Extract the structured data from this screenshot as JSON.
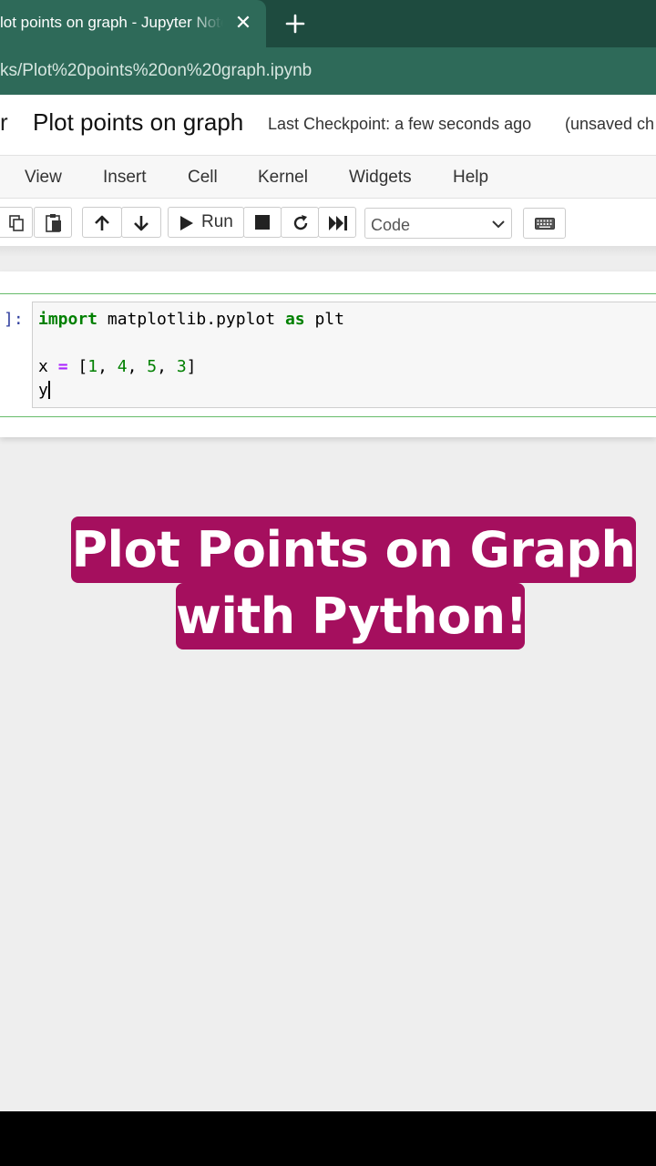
{
  "browser": {
    "tab_title": "lot points on graph - Jupyter Notebook",
    "tab_close": "✕",
    "url": "ks/Plot%20points%20on%20graph.ipynb"
  },
  "notebook_header": {
    "logo_fragment": "r",
    "title": "Plot points on graph",
    "checkpoint": "Last Checkpoint: a few seconds ago",
    "unsaved": "(unsaved ch"
  },
  "menu": {
    "view": "View",
    "insert": "Insert",
    "cell": "Cell",
    "kernel": "Kernel",
    "widgets": "Widgets",
    "help": "Help"
  },
  "toolbar": {
    "run_label": "Run",
    "cell_type": "Code"
  },
  "cell": {
    "prompt": "]:",
    "line1": {
      "kw1": "import",
      "mid": " matplotlib.pyplot ",
      "kw2": "as",
      "end": " plt"
    },
    "line3": {
      "var": "x ",
      "op": "=",
      "open": " [",
      "n1": "1",
      "c1": ", ",
      "n2": "4",
      "c2": ", ",
      "n3": "5",
      "c3": ", ",
      "n4": "3",
      "close": "]"
    },
    "line4": "y"
  },
  "caption": {
    "line1": "Plot Points on Graph",
    "line2": "with Python!"
  },
  "colors": {
    "tab_bar": "#1e4b3f",
    "tab_active": "#2e6a59",
    "caption_bg": "#a50f5e",
    "cell_border": "#66bb6a",
    "keyword": "#008000",
    "operator": "#aa22ff"
  },
  "icons": {
    "toolbar": [
      "copy-icon",
      "paste-icon",
      "arrow-up-icon",
      "arrow-down-icon",
      "play-icon",
      "stop-icon",
      "restart-icon",
      "fast-forward-icon",
      "chevron-down-icon",
      "keyboard-icon"
    ],
    "tabs": [
      "close-icon",
      "plus-icon"
    ]
  }
}
